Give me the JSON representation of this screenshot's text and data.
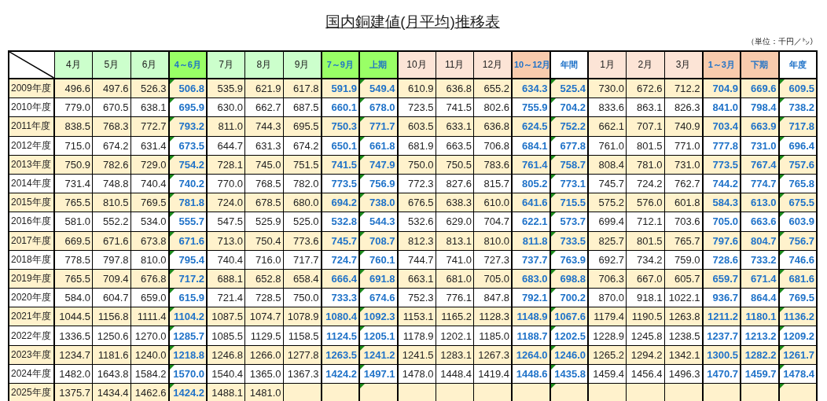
{
  "title": "国内銅建値(月平均)推移表",
  "unit_note": "（単位：千円／㌧）",
  "table": {
    "columns": [
      {
        "label": "4月",
        "kind": "month",
        "color": "#ccffcc",
        "flagged": false
      },
      {
        "label": "5月",
        "kind": "month",
        "color": "#ccffcc",
        "flagged": false
      },
      {
        "label": "6月",
        "kind": "month",
        "color": "#ccffcc",
        "flagged": false
      },
      {
        "label": "4～6月",
        "kind": "total",
        "color": "#99ff66",
        "flagged": true
      },
      {
        "label": "7月",
        "kind": "month",
        "color": "#ccffcc",
        "flagged": false
      },
      {
        "label": "8月",
        "kind": "month",
        "color": "#ccffcc",
        "flagged": false
      },
      {
        "label": "9月",
        "kind": "month",
        "color": "#ccffcc",
        "flagged": false
      },
      {
        "label": "7～9月",
        "kind": "total",
        "color": "#99ff66",
        "flagged": false
      },
      {
        "label": "上期",
        "kind": "total",
        "color": "#99ff66",
        "flagged": true
      },
      {
        "label": "10月",
        "kind": "month",
        "color": "#fce4d6",
        "flagged": false
      },
      {
        "label": "11月",
        "kind": "month",
        "color": "#fce4d6",
        "flagged": false
      },
      {
        "label": "12月",
        "kind": "month",
        "color": "#fce4d6",
        "flagged": false
      },
      {
        "label": "10～12月",
        "kind": "total",
        "color": "#f8cbad",
        "flagged": false
      },
      {
        "label": "年間",
        "kind": "total",
        "color": "#ffffff",
        "flagged": true
      },
      {
        "label": "1月",
        "kind": "month",
        "color": "#fce4d6",
        "flagged": false
      },
      {
        "label": "2月",
        "kind": "month",
        "color": "#fce4d6",
        "flagged": false
      },
      {
        "label": "3月",
        "kind": "month",
        "color": "#fce4d6",
        "flagged": false
      },
      {
        "label": "1～3月",
        "kind": "total",
        "color": "#f8cbad",
        "flagged": false
      },
      {
        "label": "下期",
        "kind": "total",
        "color": "#f8cbad",
        "flagged": false
      },
      {
        "label": "年度",
        "kind": "total",
        "color": "#ffffff",
        "flagged": true
      }
    ],
    "rows": [
      {
        "label": "2009年度",
        "values": [
          "496.6",
          "497.6",
          "526.3",
          "506.8",
          "535.9",
          "621.9",
          "617.8",
          "591.9",
          "549.4",
          "610.9",
          "636.8",
          "655.2",
          "634.3",
          "525.4",
          "730.0",
          "672.6",
          "712.2",
          "704.9",
          "669.6",
          "609.5"
        ]
      },
      {
        "label": "2010年度",
        "values": [
          "779.0",
          "670.5",
          "638.1",
          "695.9",
          "630.0",
          "662.7",
          "687.5",
          "660.1",
          "678.0",
          "723.5",
          "741.5",
          "802.6",
          "755.9",
          "704.2",
          "833.6",
          "863.1",
          "826.3",
          "841.0",
          "798.4",
          "738.2"
        ]
      },
      {
        "label": "2011年度",
        "values": [
          "838.5",
          "768.3",
          "772.7",
          "793.2",
          "811.0",
          "744.3",
          "695.5",
          "750.3",
          "771.7",
          "603.5",
          "633.1",
          "636.8",
          "624.5",
          "752.2",
          "662.1",
          "707.1",
          "740.9",
          "703.4",
          "663.9",
          "717.8"
        ]
      },
      {
        "label": "2012年度",
        "values": [
          "715.0",
          "674.2",
          "631.4",
          "673.5",
          "644.7",
          "631.3",
          "674.2",
          "650.1",
          "661.8",
          "681.9",
          "663.5",
          "706.8",
          "684.1",
          "677.8",
          "761.0",
          "801.5",
          "771.0",
          "777.8",
          "731.0",
          "696.4"
        ]
      },
      {
        "label": "2013年度",
        "values": [
          "750.9",
          "782.6",
          "729.0",
          "754.2",
          "728.1",
          "745.0",
          "751.5",
          "741.5",
          "747.9",
          "750.0",
          "750.5",
          "783.6",
          "761.4",
          "758.7",
          "808.4",
          "781.0",
          "731.0",
          "773.5",
          "767.4",
          "757.6"
        ]
      },
      {
        "label": "2014年度",
        "values": [
          "731.4",
          "748.8",
          "740.4",
          "740.2",
          "770.0",
          "768.5",
          "782.0",
          "773.5",
          "756.9",
          "772.3",
          "827.6",
          "815.7",
          "805.2",
          "773.1",
          "745.7",
          "724.2",
          "762.7",
          "744.2",
          "774.7",
          "765.8"
        ]
      },
      {
        "label": "2015年度",
        "values": [
          "765.5",
          "810.5",
          "769.5",
          "781.8",
          "724.0",
          "678.5",
          "680.0",
          "694.2",
          "738.0",
          "676.5",
          "638.3",
          "610.0",
          "641.6",
          "715.5",
          "575.2",
          "576.0",
          "601.8",
          "584.3",
          "613.0",
          "675.5"
        ]
      },
      {
        "label": "2016年度",
        "values": [
          "581.0",
          "552.2",
          "534.0",
          "555.7",
          "547.5",
          "525.9",
          "525.0",
          "532.8",
          "544.3",
          "532.6",
          "629.0",
          "704.7",
          "622.1",
          "573.7",
          "699.4",
          "712.1",
          "703.6",
          "705.0",
          "663.6",
          "603.9"
        ]
      },
      {
        "label": "2017年度",
        "values": [
          "669.5",
          "671.6",
          "673.8",
          "671.6",
          "713.0",
          "750.4",
          "773.6",
          "745.7",
          "708.7",
          "812.3",
          "813.1",
          "810.0",
          "811.8",
          "733.5",
          "825.7",
          "801.5",
          "765.7",
          "797.6",
          "804.7",
          "756.7"
        ]
      },
      {
        "label": "2018年度",
        "values": [
          "778.5",
          "797.8",
          "810.0",
          "795.4",
          "740.4",
          "716.0",
          "717.7",
          "724.7",
          "760.1",
          "744.7",
          "741.0",
          "727.3",
          "737.7",
          "763.9",
          "692.7",
          "734.2",
          "759.0",
          "728.6",
          "733.2",
          "746.6"
        ]
      },
      {
        "label": "2019年度",
        "values": [
          "765.5",
          "709.4",
          "676.8",
          "717.2",
          "688.1",
          "652.8",
          "658.4",
          "666.4",
          "691.8",
          "663.1",
          "681.0",
          "705.0",
          "683.0",
          "698.8",
          "706.3",
          "667.0",
          "605.7",
          "659.7",
          "671.4",
          "681.6"
        ]
      },
      {
        "label": "2020年度",
        "values": [
          "584.0",
          "604.7",
          "659.0",
          "615.9",
          "721.4",
          "728.5",
          "750.0",
          "733.3",
          "674.6",
          "752.3",
          "776.1",
          "847.8",
          "792.1",
          "700.2",
          "870.0",
          "918.1",
          "1022.1",
          "936.7",
          "864.4",
          "769.5"
        ]
      },
      {
        "label": "2021年度",
        "values": [
          "1044.5",
          "1156.8",
          "1111.4",
          "1104.2",
          "1087.5",
          "1074.7",
          "1078.9",
          "1080.4",
          "1092.3",
          "1153.1",
          "1165.2",
          "1128.3",
          "1148.9",
          "1067.6",
          "1179.4",
          "1190.5",
          "1263.8",
          "1211.2",
          "1180.1",
          "1136.2"
        ]
      },
      {
        "label": "2022年度",
        "values": [
          "1336.5",
          "1250.6",
          "1270.0",
          "1285.7",
          "1085.5",
          "1129.5",
          "1158.5",
          "1124.5",
          "1205.1",
          "1178.9",
          "1202.1",
          "1185.0",
          "1188.7",
          "1202.5",
          "1228.9",
          "1245.8",
          "1238.5",
          "1237.7",
          "1213.2",
          "1209.2"
        ]
      },
      {
        "label": "2023年度",
        "values": [
          "1234.7",
          "1181.6",
          "1240.0",
          "1218.8",
          "1246.8",
          "1266.0",
          "1277.8",
          "1263.5",
          "1241.2",
          "1241.5",
          "1283.1",
          "1267.3",
          "1264.0",
          "1246.0",
          "1265.2",
          "1294.2",
          "1342.1",
          "1300.5",
          "1282.2",
          "1261.7"
        ]
      },
      {
        "label": "2024年度",
        "values": [
          "1482.0",
          "1643.8",
          "1584.2",
          "1570.0",
          "1540.4",
          "1365.0",
          "1367.3",
          "1424.2",
          "1497.1",
          "1478.0",
          "1448.4",
          "1419.4",
          "1448.6",
          "1435.8",
          "1459.4",
          "1456.4",
          "1496.3",
          "1470.7",
          "1459.7",
          "1478.4"
        ]
      },
      {
        "label": "2025年度",
        "values": [
          "1375.7",
          "1434.4",
          "1462.6",
          "1424.2",
          "1488.1",
          "1481.0"
        ]
      }
    ]
  }
}
